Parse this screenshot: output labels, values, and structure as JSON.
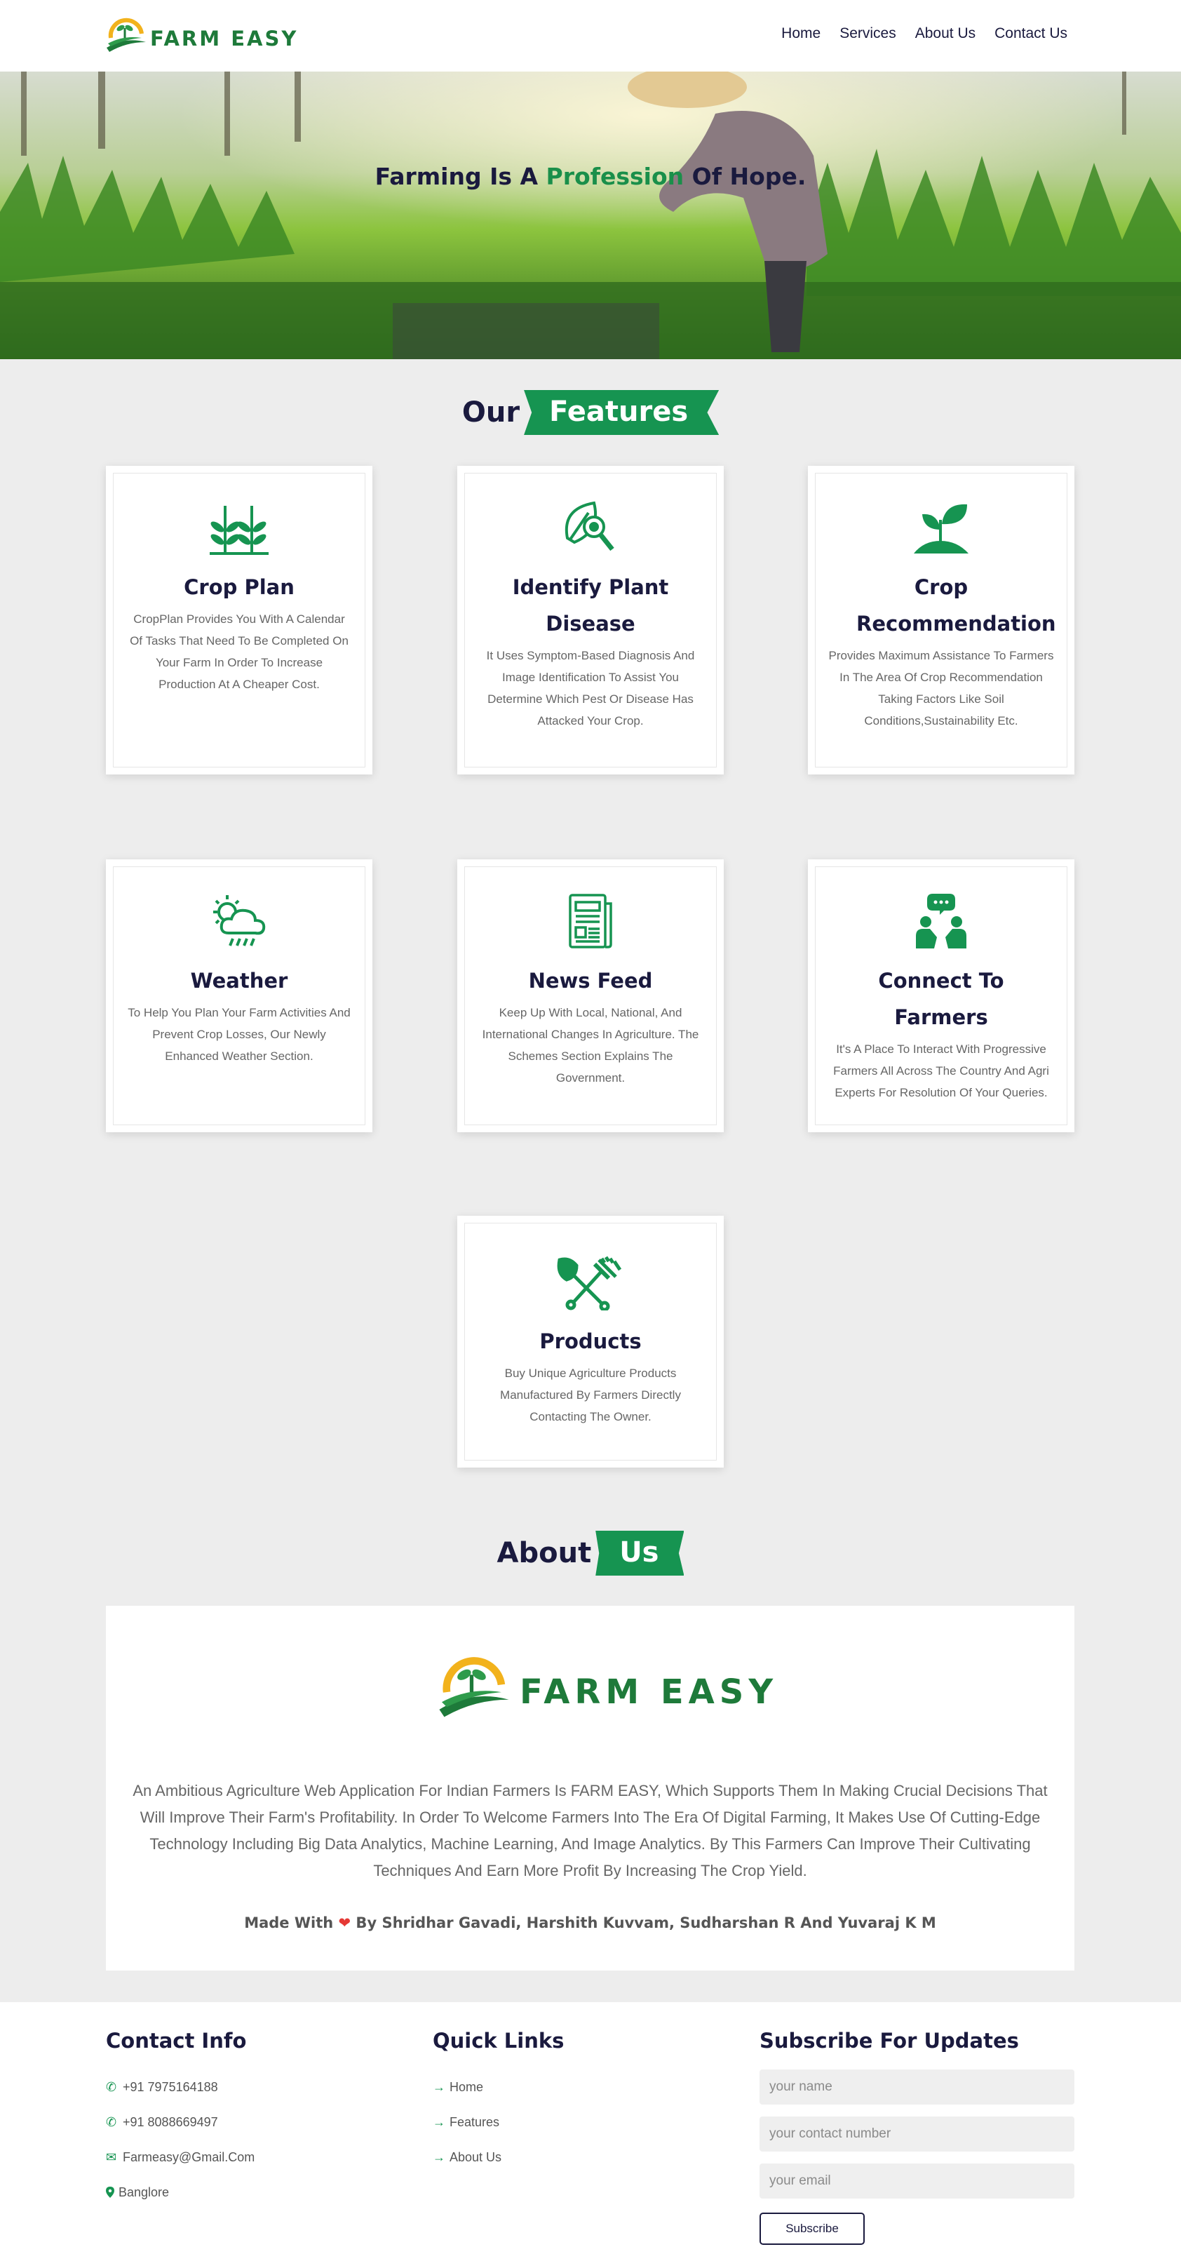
{
  "header": {
    "logo_text": "FARM EASY",
    "nav": [
      "Home",
      "Services",
      "About Us",
      "Contact Us"
    ]
  },
  "hero": {
    "title_part1": "Farming Is A ",
    "title_highlight": "Profession",
    "title_part2": " Of Hope."
  },
  "features_heading": {
    "left": "Our",
    "ribbon": "Features"
  },
  "features": [
    {
      "icon": "seedling-plants-icon",
      "title": "Crop Plan",
      "text": "CropPlan Provides You With A Calendar Of Tasks That Need To Be Completed On Your Farm In Order To Increase Production At A Cheaper Cost."
    },
    {
      "icon": "leaf-magnifier-icon",
      "title": "Identify Plant Disease",
      "text": "It Uses Symptom-Based Diagnosis And Image Identification To Assist You Determine Which Pest Or Disease Has Attacked Your Crop."
    },
    {
      "icon": "sprout-soil-icon",
      "title": "Crop Recommendation",
      "text": "Provides Maximum Assistance To Farmers In The Area Of Crop Recommendation Taking Factors Like Soil Conditions,Sustainability Etc."
    },
    {
      "icon": "weather-cloud-rain-icon",
      "title": "Weather",
      "text": "To Help You Plan Your Farm Activities And Prevent Crop Losses, Our Newly Enhanced Weather Section."
    },
    {
      "icon": "newspaper-icon",
      "title": "News Feed",
      "text": "Keep Up With Local, National, And International Changes In Agriculture. The Schemes Section Explains The Government."
    },
    {
      "icon": "people-chat-icon",
      "title": "Connect To Farmers",
      "text": "It's A Place To Interact With Progressive Farmers All Across The Country And Agri Experts For Resolution Of Your Queries."
    },
    {
      "icon": "shovel-rake-icon",
      "title": "Products",
      "text": "Buy Unique Agriculture Products Manufactured By Farmers Directly Contacting The Owner."
    }
  ],
  "about_heading": {
    "left": "About",
    "ribbon": "Us"
  },
  "about": {
    "logo_text": "FARM EASY",
    "text": "An Ambitious Agriculture Web Application For Indian Farmers Is FARM EASY, Which Supports Them In Making Crucial Decisions That Will Improve Their Farm's Profitability. In Order To Welcome Farmers Into The Era Of Digital Farming, It Makes Use Of Cutting-Edge Technology Including Big Data Analytics, Machine Learning, And Image Analytics. By This Farmers Can Improve Their Cultivating Techniques And Earn More Profit By Increasing The Crop Yield.",
    "credit_before": "Made With ",
    "credit_after": " By Shridhar Gavadi, Harshith Kuvvam, Sudharshan R And Yuvaraj K M"
  },
  "footer": {
    "contact": {
      "title": "Contact Info",
      "items": [
        {
          "icon": "phone-icon",
          "text": "+91 7975164188"
        },
        {
          "icon": "phone-icon",
          "text": "+91 8088669497"
        },
        {
          "icon": "envelope-icon",
          "text": "Farmeasy@Gmail.Com"
        },
        {
          "icon": "map-pin-icon",
          "text": "Banglore"
        }
      ]
    },
    "links": {
      "title": "Quick Links",
      "items": [
        "Home",
        "Features",
        "About Us"
      ]
    },
    "subscribe": {
      "title": "Subscribe For Updates",
      "name_placeholder": "your name",
      "contact_placeholder": "your contact number",
      "email_placeholder": "your email",
      "button": "Subscribe"
    }
  },
  "colors": {
    "green": "#169451",
    "navy": "#1a1a3e",
    "logo_green": "#1e7a3a",
    "sun": "#f2b21c"
  }
}
